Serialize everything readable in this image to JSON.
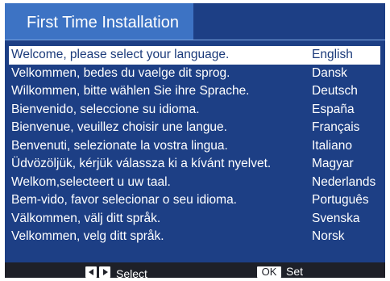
{
  "title": "First Time Installation",
  "selected_index": 0,
  "languages": [
    {
      "message": "Welcome, please select your language.",
      "language": "English"
    },
    {
      "message": "Velkommen, bedes du vaelge dit sprog.",
      "language": "Dansk"
    },
    {
      "message": "Wilkommen, bitte wählen Sie ihre Sprache.",
      "language": "Deutsch"
    },
    {
      "message": "Bienvenido, seleccione su idioma.",
      "language": "España"
    },
    {
      "message": "Bienvenue, veuillez choisir une langue.",
      "language": "Français"
    },
    {
      "message": "Benvenuti, selezionate la vostra lingua.",
      "language": "Italiano"
    },
    {
      "message": "Üdvözöljük, kérjük válassza ki a kívánt nyelvet.",
      "language": "Magyar"
    },
    {
      "message": "Welkom,selecteert u uw taal.",
      "language": "Nederlands"
    },
    {
      "message": "Bem-vido, favor selecionar o seu idioma.",
      "language": "Português"
    },
    {
      "message": "Välkommen, välj ditt språk.",
      "language": "Svenska"
    },
    {
      "message": "Velkommen, velg ditt språk.",
      "language": "Norsk"
    }
  ],
  "footer": {
    "select_label": "Select",
    "ok_key": "OK",
    "set_label": "Set",
    "select_icons": [
      "arrow-left-key-icon",
      "arrow-right-key-icon"
    ]
  },
  "colors": {
    "background": "#1d3f85",
    "title_tab": "#3d73c4",
    "selected_row": "#ffffff",
    "selected_text": "#1b3a7a",
    "footer_bar": "#1e2028"
  }
}
